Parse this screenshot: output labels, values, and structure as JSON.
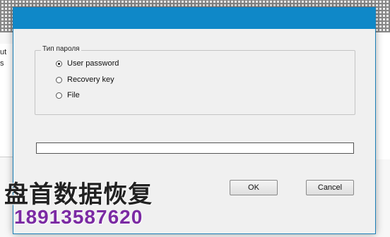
{
  "background": {
    "header_fragment": "ut",
    "list_fragment": "s"
  },
  "dialog": {
    "group_label": "Тип пароля",
    "options": [
      {
        "label": "User password",
        "selected": true
      },
      {
        "label": "Recovery key",
        "selected": false
      },
      {
        "label": "File",
        "selected": false
      }
    ],
    "input_value": "",
    "ok_label": "OK",
    "cancel_label": "Cancel"
  },
  "watermark": {
    "title": "盘首数据恢复",
    "phone": "18913587620"
  },
  "colors": {
    "titlebar": "#0f88c8",
    "watermark_phone": "#7b2aa3"
  }
}
